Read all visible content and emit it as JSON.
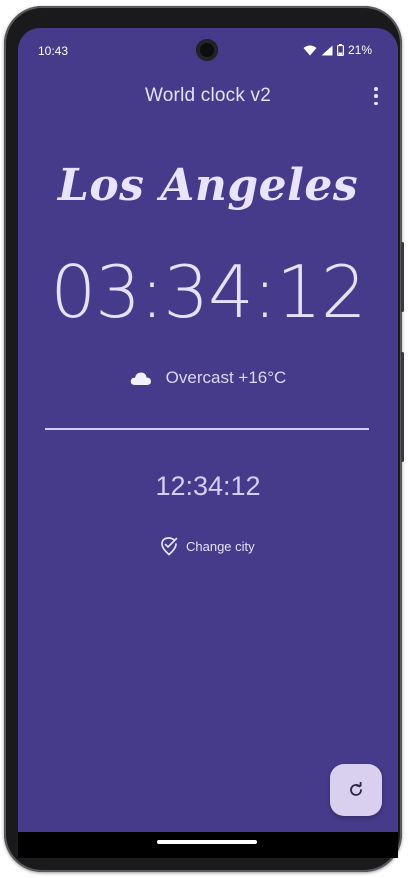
{
  "status_bar": {
    "time": "10:43",
    "battery": "21%",
    "icons": [
      "wifi-icon",
      "signal-icon",
      "battery-icon"
    ]
  },
  "app_bar": {
    "title": "World clock v2",
    "menu_icon": "more-vert-icon"
  },
  "clock": {
    "city": "Los Angeles",
    "time": "03:34:12",
    "weather_icon": "cloud-icon",
    "weather": "Overcast +16°C",
    "local_time": "12:34:12"
  },
  "actions": {
    "change_city_label": "Change city",
    "change_city_icon": "location-check-icon",
    "refresh_icon": "refresh-icon"
  },
  "colors": {
    "background": "#463a8a",
    "text": "#e6e0fb",
    "fab": "#d8d0ee"
  }
}
